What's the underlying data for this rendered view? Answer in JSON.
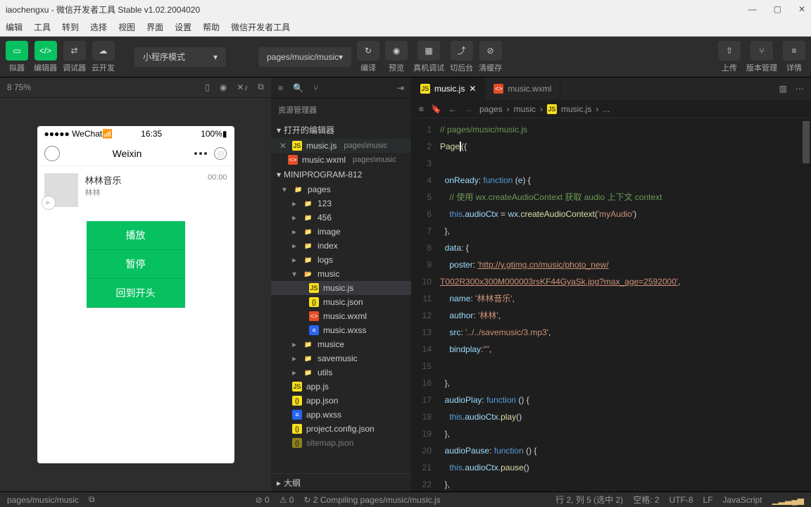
{
  "titlebar": {
    "title": "iaochengxu - 微信开发者工具 Stable v1.02.2004020"
  },
  "menu": [
    "编辑",
    "工具",
    "转到",
    "选择",
    "视图",
    "界面",
    "设置",
    "帮助",
    "微信开发者工具"
  ],
  "toolbar": {
    "simulator": "拟器",
    "editor": "编辑器",
    "debugger": "调试器",
    "cloud": "云开发",
    "mode": "小程序模式",
    "page": "pages/music/music",
    "compile": "编译",
    "preview": "预览",
    "realdebug": "真机调试",
    "background": "切后台",
    "clearcache": "清缓存",
    "upload": "上传",
    "version": "版本管理",
    "details": "详情"
  },
  "sim": {
    "zoom": "8 75%",
    "carrier": "●●●●● WeChat",
    "time": "16:35",
    "battery": "100%",
    "navtitle": "Weixin",
    "audio": {
      "name": "林林音乐",
      "author": "林林",
      "time": "00:00"
    },
    "btns": {
      "play": "播放",
      "pause": "暂停",
      "restart": "回到开头"
    }
  },
  "explorer": {
    "title": "资源管理器",
    "openeditors": "打开的编辑器",
    "open": [
      {
        "name": "music.js",
        "path": "pages\\music"
      },
      {
        "name": "music.wxml",
        "path": "pages\\music"
      }
    ],
    "project": "MINIPROGRAM-812",
    "tree": {
      "pages": "pages",
      "folders": [
        "123",
        "456",
        "image",
        "index",
        "logs"
      ],
      "music": "music",
      "musicfiles": [
        "music.js",
        "music.json",
        "music.wxml",
        "music.wxss"
      ],
      "after": [
        "musice",
        "savemusic",
        "utils"
      ],
      "rootfiles": [
        "app.js",
        "app.json",
        "app.wxss",
        "project.config.json",
        "sitemap.json"
      ]
    },
    "outline": "大纲"
  },
  "tabs": {
    "t1": "music.js",
    "t2": "music.wxml"
  },
  "crumbs": {
    "pages": "pages",
    "music": "music",
    "file": "music.js",
    "more": "..."
  },
  "code": {
    "l1": "// pages/music/music.js",
    "l2a": "Page",
    "l2b": "({",
    "l4a": "onReady",
    "l4b": "function",
    "l4c": "e",
    "l5": "// 使用 wx.createAudioContext 获取 audio 上下文 context",
    "l6a": "this",
    "l6b": "audioCtx",
    "l6c": "wx",
    "l6d": "createAudioContext",
    "l6e": "'myAudio'",
    "l8a": "data",
    "l9a": "poster",
    "l9b": "'http://y.gtimg.cn/music/photo_new/",
    "l10": "T002R300x300M000003rsKF44GyaSk.jpg?max_age=2592000'",
    "l11a": "name",
    "l11b": "'林林音乐'",
    "l12a": "author",
    "l12b": "'林林'",
    "l13a": "src",
    "l13b": "'../../savemusic/3.mp3'",
    "l14a": "bindplay",
    "l14b": "\"\"",
    "l17a": "audioPlay",
    "l17b": "function",
    "l18a": "this",
    "l18b": "audioCtx",
    "l18c": "play",
    "l20a": "audioPause",
    "l20b": "function",
    "l21a": "this",
    "l21b": "audioCtx",
    "l21c": "pause"
  },
  "status": {
    "errors": "0",
    "warnings": "0",
    "compiling": "2 Compiling pages/music/music.js",
    "path": "pages/music/music",
    "cursor": "行 2, 列 5 (选中 2)",
    "spaces": "空格: 2",
    "encoding": "UTF-8",
    "eol": "LF",
    "lang": "JavaScript"
  }
}
